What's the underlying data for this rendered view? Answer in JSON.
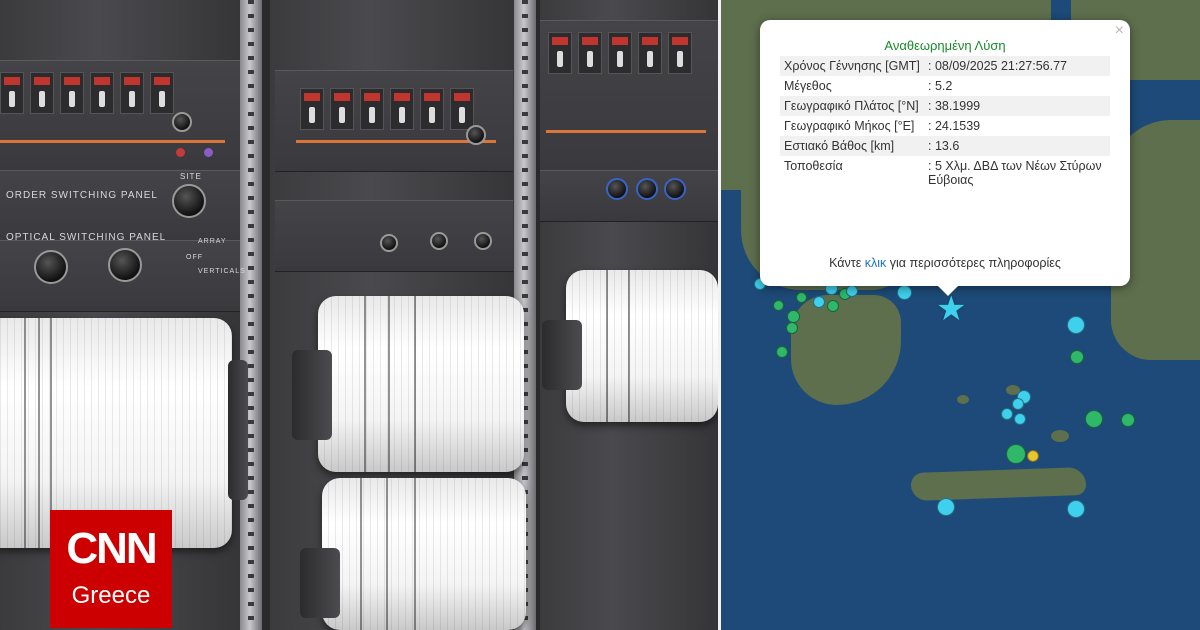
{
  "photo": {
    "panel_labels": [
      "ORDER SWITCHING PANEL",
      "OPTICAL SWITCHING PANEL",
      "SITE",
      "ARRAY",
      "OFF",
      "VERTICALS"
    ]
  },
  "logo": {
    "wordmark": "CNN",
    "edition": "Greece",
    "brand_color": "#cc0000"
  },
  "popup": {
    "title": "Αναθεωρημένη Λύση",
    "close_glyph": "×",
    "rows": [
      {
        "label": "Χρόνος Γέννησης [GMT]",
        "value": ": 08/09/2025 21:27:56.77"
      },
      {
        "label": "Μέγεθος",
        "value": ": 5.2"
      },
      {
        "label": "Γεωγραφικό Πλάτος [°N]",
        "value": ": 38.1999"
      },
      {
        "label": "Γεωγραφικό Μήκος [°E]",
        "value": ": 24.1539"
      },
      {
        "label": "Εστιακό Βάθος [km]",
        "value": ": 13.6"
      },
      {
        "label": "Τοποθεσία",
        "value": ": 5 Χλμ. ΔΒΔ των Νέων Στύρων Εύβοιας"
      }
    ],
    "footer_before": "Κάντε ",
    "footer_link": "κλικ",
    "footer_after": " για περισσότερες πληροφορίες",
    "title_color": "#1a8a2c",
    "link_color": "#1a73c7"
  },
  "map": {
    "epicenter_icon": "star-icon",
    "epicenter_glyph": "★",
    "epicenter_color": "#3fd0ee",
    "quake_colors": [
      "#3fd0ee",
      "#2fb86a",
      "#e6c531"
    ]
  }
}
